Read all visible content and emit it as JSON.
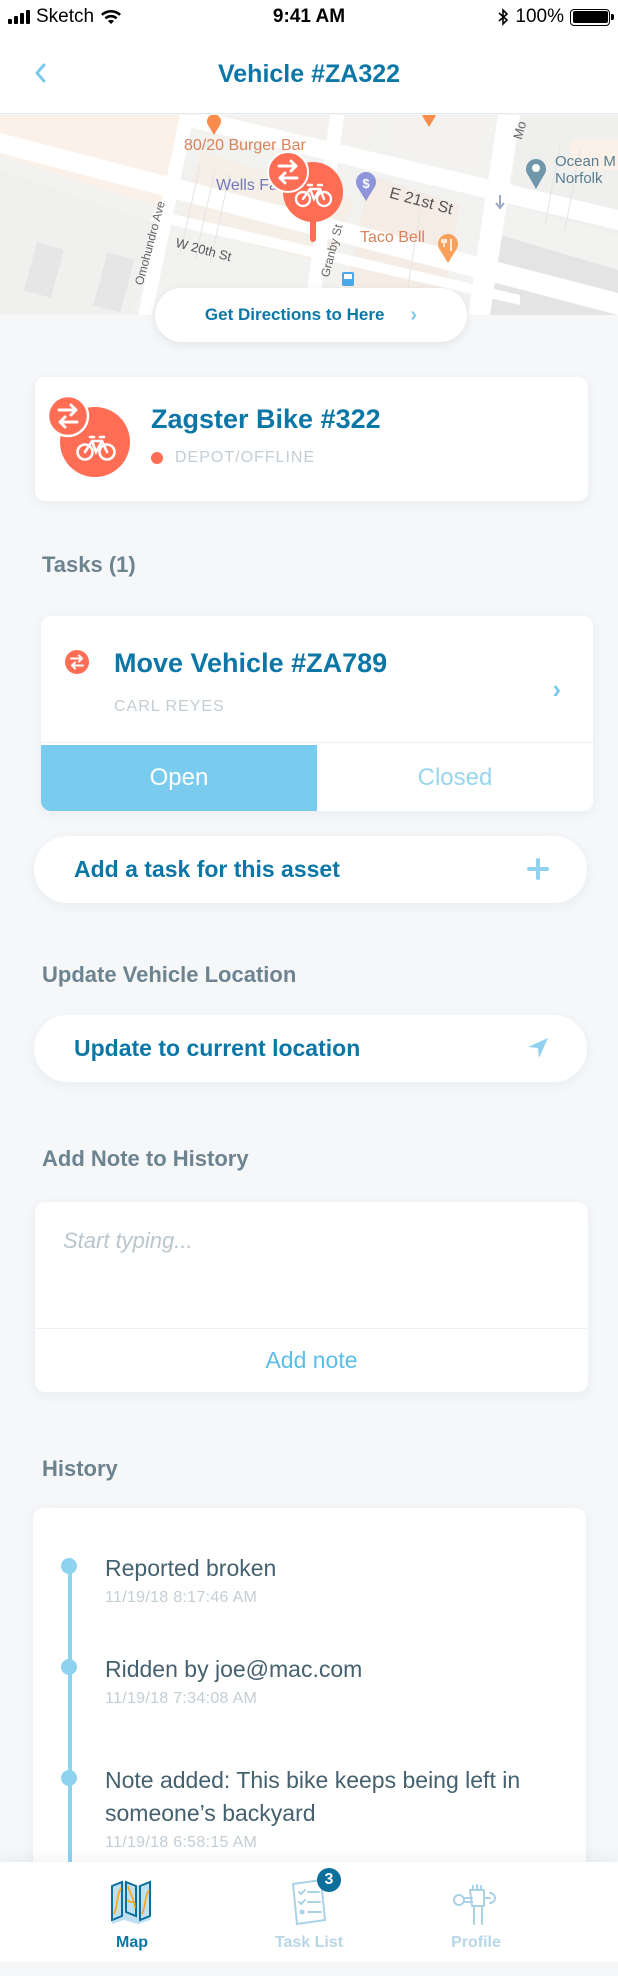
{
  "status_bar": {
    "carrier": "Sketch",
    "time": "9:41 AM",
    "battery": "100%"
  },
  "nav": {
    "title": "Vehicle #ZA322",
    "back_icon": "chevron-left-icon"
  },
  "map": {
    "labels": {
      "burger_bar": "80/20 Burger Bar",
      "wells_fargo": "Wells Fargo Bank",
      "e21st": "E 21st St",
      "w20th": "W 20th St",
      "omohundro": "Omohundro Ave",
      "granby": "Granby St",
      "taco_bell": "Taco Bell",
      "ocean_1": "Ocean M",
      "ocean_2": "Norfolk",
      "monticello": "Mo"
    },
    "directions_button": "Get Directions to Here"
  },
  "vehicle": {
    "name": "Zagster Bike #322",
    "status": "DEPOT/OFFLINE",
    "status_color": "#FF6D55"
  },
  "tasks": {
    "heading": "Tasks (1)",
    "items": [
      {
        "title": "Move Vehicle #ZA789",
        "assignee": "CARL REYES"
      }
    ],
    "segment": {
      "open": "Open",
      "closed": "Closed",
      "selected": "Open"
    },
    "add_task_label": "Add a task for this asset"
  },
  "location": {
    "heading": "Update Vehicle Location",
    "button_label": "Update to current location"
  },
  "note": {
    "heading": "Add Note to History",
    "placeholder": "Start typing...",
    "value": "",
    "add_label": "Add note"
  },
  "history": {
    "heading": "History",
    "items": [
      {
        "text": "Reported broken",
        "time": "11/19/18 8:17:46 AM"
      },
      {
        "text": "Ridden by joe@mac.com",
        "time": "11/19/18 7:34:08 AM"
      },
      {
        "text": "Note added: This bike keeps being left in someone’s backyard",
        "time": "11/19/18 6:58:15 AM"
      }
    ]
  },
  "tab_bar": {
    "tabs": [
      {
        "label": "Map",
        "icon": "map-icon",
        "active": true
      },
      {
        "label": "Task List",
        "icon": "task-list-icon",
        "badge": "3",
        "active": false
      },
      {
        "label": "Profile",
        "icon": "profile-wrench-icon",
        "active": false
      }
    ]
  },
  "colors": {
    "brand_blue": "#0C77A6",
    "light_blue": "#7ACCEF",
    "accent_red": "#FF6D55",
    "heading_gray": "#6D8490",
    "muted_gray": "#C3CDD4",
    "background": "#F5F7F9"
  }
}
